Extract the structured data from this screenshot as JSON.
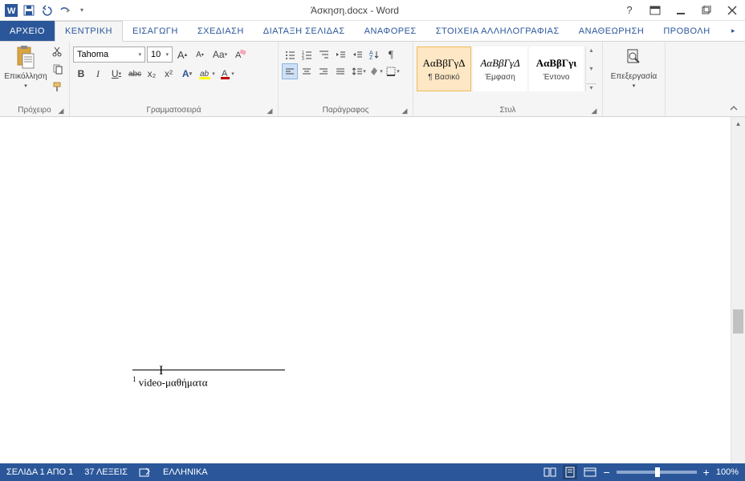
{
  "title": "Άσκηση.docx - Word",
  "tabs": {
    "file": "ΑΡΧΕΙΟ",
    "home": "ΚΕΝΤΡΙΚΗ",
    "insert": "ΕΙΣΑΓΩΓΗ",
    "design": "ΣΧΕΔΙΑΣΗ",
    "layout": "ΔΙΑΤΑΞΗ ΣΕΛΙΔΑΣ",
    "references": "ΑΝΑΦΟΡΕΣ",
    "mailings": "ΣΤΟΙΧΕΙΑ ΑΛΛΗΛΟΓΡΑΦΙΑΣ",
    "review": "ΑΝΑΘΕΩΡΗΣΗ",
    "view": "ΠΡΟΒΟΛΗ"
  },
  "groups": {
    "clipboard": "Πρόχειρο",
    "font": "Γραμματοσειρά",
    "paragraph": "Παράγραφος",
    "styles": "Στυλ",
    "editing": "Επεξεργασία"
  },
  "clipboard": {
    "paste": "Επικόλληση"
  },
  "font": {
    "name": "Tahoma",
    "size": "10",
    "bold": "B",
    "italic": "I",
    "underline": "U",
    "strike": "abc",
    "bigA": "A",
    "smallA": "A",
    "caseAa": "Aa",
    "x2": "x₂",
    "x2sup": "x²"
  },
  "styles": {
    "sample": "ΑαΒβΓγΔ",
    "sampleItalic": "ΑαΒβΓγΔ",
    "sampleBold": "ΑαΒβΓγι",
    "normal": "¶ Βασικό",
    "emphasis": "Έμφαση",
    "strong": "Έντονο"
  },
  "document": {
    "footnote_num": "1",
    "footnote_text": " video-μαθήματα"
  },
  "status": {
    "page": "ΣΕΛΙΔΑ 1 ΑΠΟ 1",
    "words": "37 ΛΕΞΕΙΣ",
    "lang": "ΕΛΛΗΝΙΚΑ",
    "zoom": "100%",
    "minus": "−",
    "plus": "+"
  }
}
